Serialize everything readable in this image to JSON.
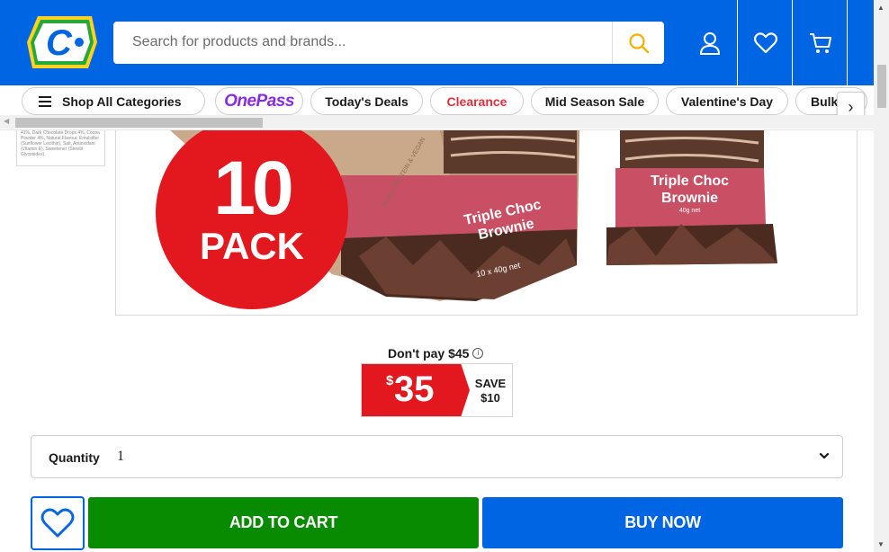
{
  "header": {
    "logo_letter": "C",
    "search_placeholder": "Search for products and brands..."
  },
  "categories": {
    "shop_all": "Shop All Categories",
    "onepass": "OnePass",
    "items": [
      "Today's Deals",
      "Clearance",
      "Mid Season Sale",
      "Valentine's Day",
      "Bulk"
    ],
    "next": "›"
  },
  "product": {
    "thumb_text": "41%, Dark Chocolate Drops 4%, Cocoa Powder 4%, Natural Flavour, Emulsifier (Sunflower Lecithin), Salt, Antioxidant (Vitamin E), Sweetener (Steviol Glycosides).",
    "badge_number": "10",
    "badge_word": "PACK",
    "box_label_line1": "Triple Choc",
    "box_label_line2": "Brownie",
    "box_net": "10 x 40g net",
    "bar_label_line1": "Triple Choc",
    "bar_label_line2": "Brownie",
    "bar_net": "40g net",
    "box_side_text": "PLANT PROTEIN & VEGAN"
  },
  "price": {
    "dont_pay": "Don't pay $45",
    "info": "i",
    "currency": "$",
    "value": "35",
    "save_line1": "SAVE",
    "save_line2": "$10"
  },
  "quantity": {
    "label": "Quantity",
    "value": "1"
  },
  "actions": {
    "add_to_cart": "ADD TO CART",
    "buy_now": "BUY NOW"
  },
  "colors": {
    "brand_blue": "#0065e3",
    "sale_red": "#e3171e",
    "cart_green": "#098b01",
    "onepass_purple": "#8a2be2",
    "search_yellow": "#f5b100"
  }
}
